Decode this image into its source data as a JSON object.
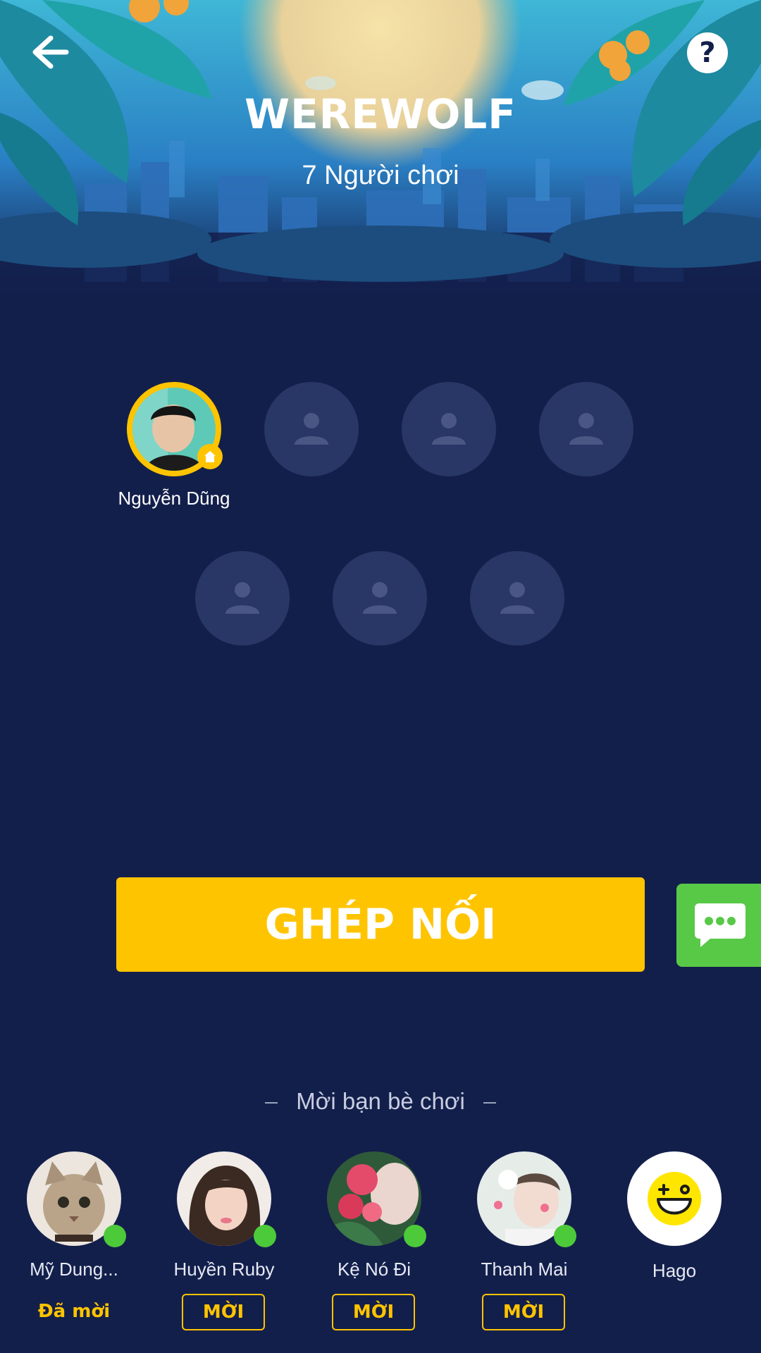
{
  "header": {
    "title": "WEREWOLF",
    "player_count": "7 Người chơi"
  },
  "icons": {
    "back": "arrow-left-icon",
    "help": "question-icon",
    "help_glyph": "?",
    "chat": "chat-bubble-icon",
    "host": "home-icon",
    "empty_seat": "person-icon"
  },
  "host": {
    "name": "Nguyễn Dũng"
  },
  "match_button": {
    "label": "GHÉP NỐI"
  },
  "invite": {
    "heading": "Mời bạn bè chơi",
    "friends": [
      {
        "name": "Mỹ Dung...",
        "status": "Đã mời",
        "online": true
      },
      {
        "name": "Huyền Ruby",
        "action": "MỜI",
        "online": true
      },
      {
        "name": "Kệ Nó Đi",
        "action": "MỜI",
        "online": true
      },
      {
        "name": "Thanh Mai",
        "action": "MỜI",
        "online": true
      },
      {
        "name": "Hago",
        "online": false
      }
    ]
  },
  "colors": {
    "background": "#131f4b",
    "accent": "#ffc400",
    "seat": "#283766",
    "chat": "#58c947",
    "online": "#4dca3a"
  }
}
